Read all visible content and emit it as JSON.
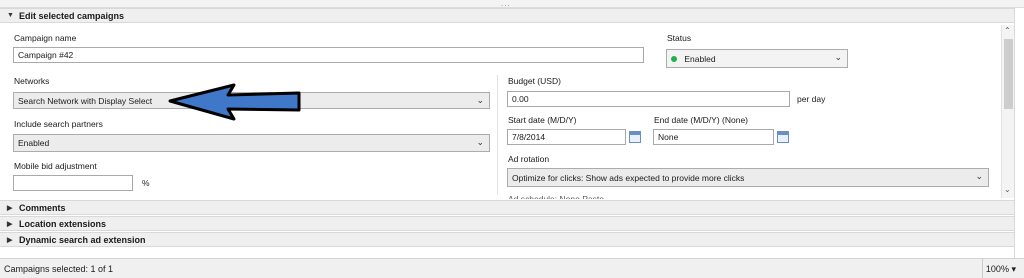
{
  "header": {
    "grip": "...",
    "edit_title": "Edit selected campaigns"
  },
  "campaign": {
    "name_label": "Campaign name",
    "name_value": "Campaign #42",
    "status_label": "Status",
    "status_value": "Enabled",
    "status_color": "#21b04b"
  },
  "networks": {
    "label": "Networks",
    "value": "Search Network with Display Select"
  },
  "search_partners": {
    "label": "Include search partners",
    "value": "Enabled"
  },
  "mobile_bid": {
    "label": "Mobile bid adjustment",
    "value": "",
    "unit": "%"
  },
  "budget": {
    "label": "Budget (USD)",
    "value": "0.00",
    "unit": "per day"
  },
  "dates": {
    "start_label": "Start date (M/D/Y)",
    "start_value": "7/8/2014",
    "end_label": "End date (M/D/Y) (None)",
    "end_value": "None"
  },
  "ad_rotation": {
    "label": "Ad rotation",
    "value": "Optimize for clicks: Show ads expected to provide more clicks"
  },
  "ad_schedule_partial": "Ad schedule:  None   Paste",
  "sections": [
    {
      "label": "Comments"
    },
    {
      "label": "Location extensions"
    },
    {
      "label": "Dynamic search ad extension"
    }
  ],
  "statusbar": {
    "selected": "Campaigns selected: 1 of 1",
    "zoom": "100%"
  },
  "annotation": {
    "arrow_color": "#3f78c9",
    "arrow_outline": "#000000"
  }
}
